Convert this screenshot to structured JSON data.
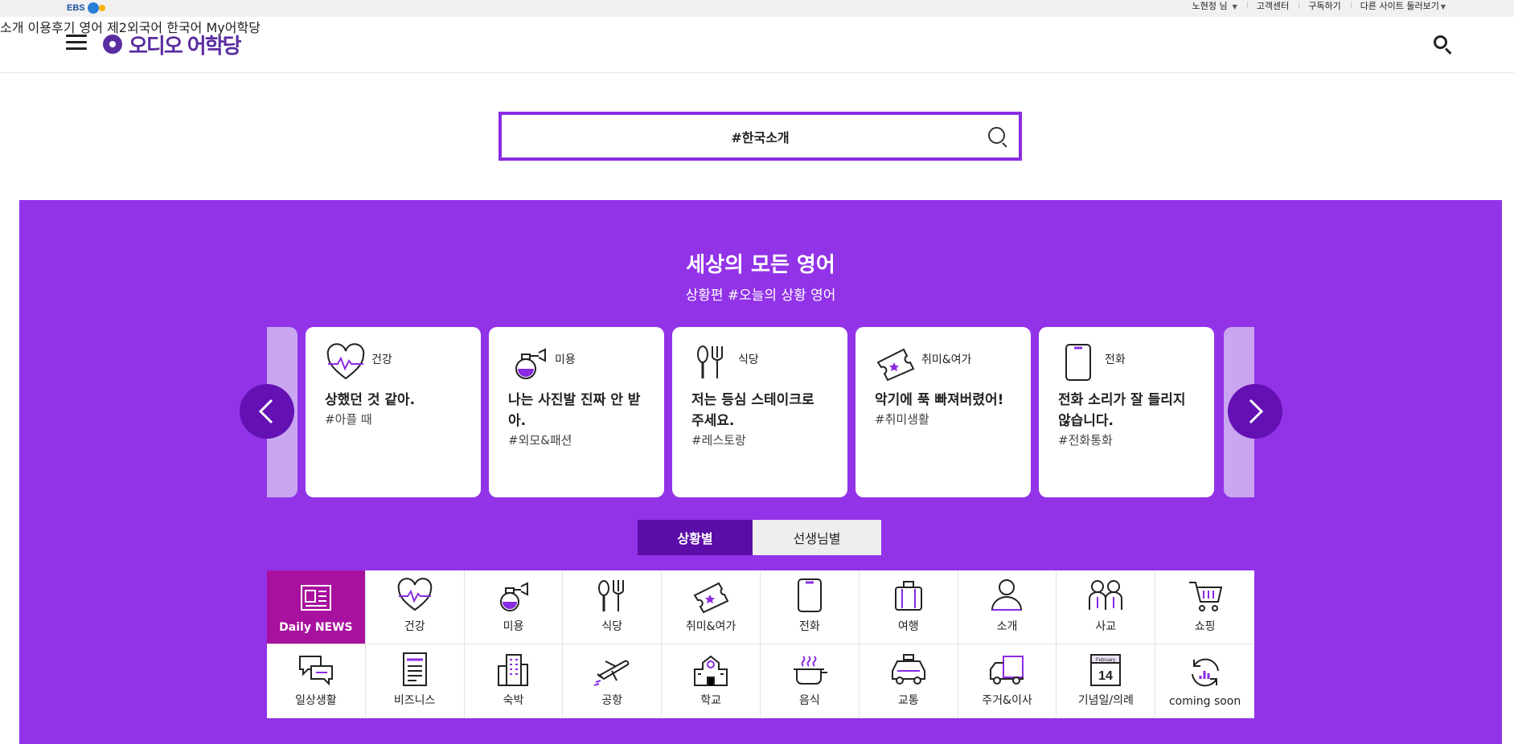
{
  "util": {
    "logo_text": "EBS",
    "user": "노현정 님",
    "links": [
      "고객센터",
      "구독하기",
      "다른 사이트 둘러보기"
    ]
  },
  "header": {
    "brand": "오디오 어학당",
    "nav": [
      "소개",
      "이용후기",
      "영어",
      "제2외국어",
      "한국어",
      "My어학당"
    ]
  },
  "search": {
    "value": "#한국소개"
  },
  "section": {
    "title": "세상의 모든 영어",
    "subtitle": "상황편 #오늘의 상황 영어"
  },
  "cards": [
    {
      "category": "건강",
      "icon": "heart-pulse-icon",
      "phrase": "상했던 것 같아.",
      "tag": "#아플 때"
    },
    {
      "category": "미용",
      "icon": "perfume-icon",
      "phrase": "나는 사진발 진짜 안 받아.",
      "tag": "#외모&패션"
    },
    {
      "category": "식당",
      "icon": "utensils-icon",
      "phrase": "저는 등심 스테이크로 주세요.",
      "tag": "#레스토랑"
    },
    {
      "category": "취미&여가",
      "icon": "ticket-icon",
      "phrase": "악기에 푹 빠져버렸어!",
      "tag": "#취미생활"
    },
    {
      "category": "전화",
      "icon": "phone-icon",
      "phrase": "전화 소리가 잘 들리지 않습니다.",
      "tag": "#전화통화"
    }
  ],
  "tabs": {
    "situation": "상황별",
    "teacher": "선생님별"
  },
  "categories": [
    {
      "label": "Daily NEWS",
      "icon": "newspaper-icon"
    },
    {
      "label": "건강",
      "icon": "heart-pulse-icon"
    },
    {
      "label": "미용",
      "icon": "perfume-icon"
    },
    {
      "label": "식당",
      "icon": "utensils-icon"
    },
    {
      "label": "취미&여가",
      "icon": "ticket-icon"
    },
    {
      "label": "전화",
      "icon": "phone-icon"
    },
    {
      "label": "여행",
      "icon": "suitcase-icon"
    },
    {
      "label": "소개",
      "icon": "person-icon"
    },
    {
      "label": "사교",
      "icon": "people-icon"
    },
    {
      "label": "쇼핑",
      "icon": "cart-icon"
    },
    {
      "label": "일상생활",
      "icon": "chat-icon"
    },
    {
      "label": "비즈니스",
      "icon": "document-icon"
    },
    {
      "label": "숙박",
      "icon": "building-icon"
    },
    {
      "label": "공항",
      "icon": "airplane-icon"
    },
    {
      "label": "학교",
      "icon": "school-icon"
    },
    {
      "label": "음식",
      "icon": "pot-icon"
    },
    {
      "label": "교통",
      "icon": "taxi-icon"
    },
    {
      "label": "주거&이사",
      "icon": "truck-icon"
    },
    {
      "label": "기념일/의례",
      "icon": "calendar-icon",
      "calendar_month": "February",
      "calendar_day": "14"
    },
    {
      "label": "coming soon",
      "icon": "refresh-icon"
    }
  ],
  "colors": {
    "brand_purple": "#5a2da0",
    "section_purple": "#9233e8",
    "dark_purple": "#5c0da8",
    "active_magenta": "#a8119e",
    "icon_accent": "#8a2be2"
  }
}
